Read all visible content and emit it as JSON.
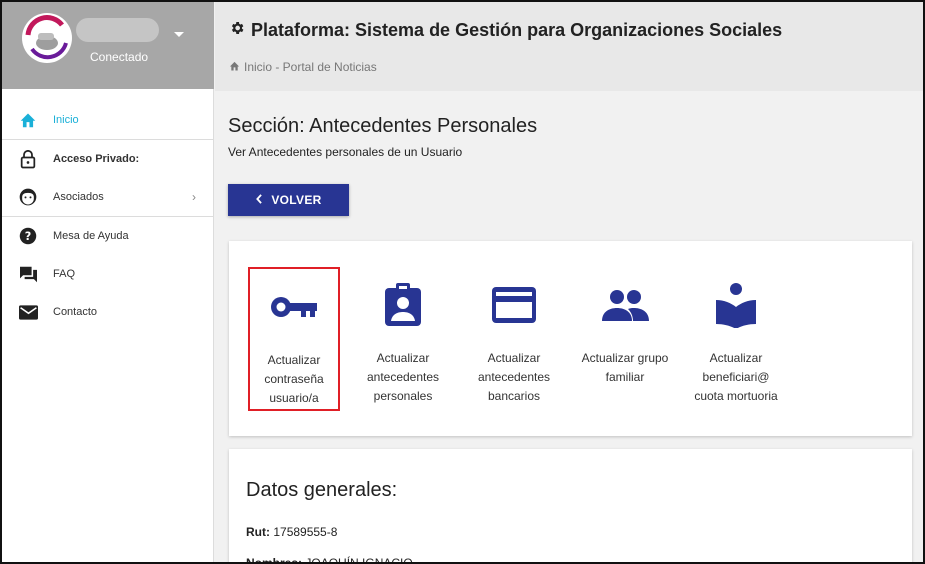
{
  "sidebar": {
    "user_status": "Conectado",
    "items": [
      {
        "label": "Inicio",
        "icon": "home-icon"
      },
      {
        "label": "Acceso Privado:",
        "icon": "lock-icon"
      },
      {
        "label": "Asociados",
        "icon": "face-icon"
      },
      {
        "label": "Mesa de Ayuda",
        "icon": "help-icon"
      },
      {
        "label": "FAQ",
        "icon": "forum-icon"
      },
      {
        "label": "Contacto",
        "icon": "mail-icon"
      }
    ]
  },
  "header": {
    "title": "Plataforma: Sistema de Gestión para Organizaciones Sociales",
    "breadcrumb": "Inicio - Portal de Noticias"
  },
  "section": {
    "title": "Sección: Antecedentes Personales",
    "subtitle": "Ver Antecedentes personales de un Usuario",
    "back_label": "VOLVER"
  },
  "actions": [
    {
      "label": "Actualizar contraseña usuario/a",
      "icon": "key-icon"
    },
    {
      "label": "Actualizar antecedentes personales",
      "icon": "badge-icon"
    },
    {
      "label": "Actualizar antecedentes bancarios",
      "icon": "credit-card-icon"
    },
    {
      "label": "Actualizar grupo familiar",
      "icon": "group-icon"
    },
    {
      "label": "Actualizar beneficiari@ cuota mortuoria",
      "icon": "book-reader-icon"
    }
  ],
  "datos": {
    "title": "Datos generales:",
    "rut_label": "Rut:",
    "rut_value": "17589555-8",
    "nombres_label": "Nombres:",
    "nombres_value": "JOAQUÍN IGNACIO"
  },
  "colors": {
    "accent": "#283593",
    "active": "#1ab0d8",
    "highlight": "#e01f26"
  }
}
